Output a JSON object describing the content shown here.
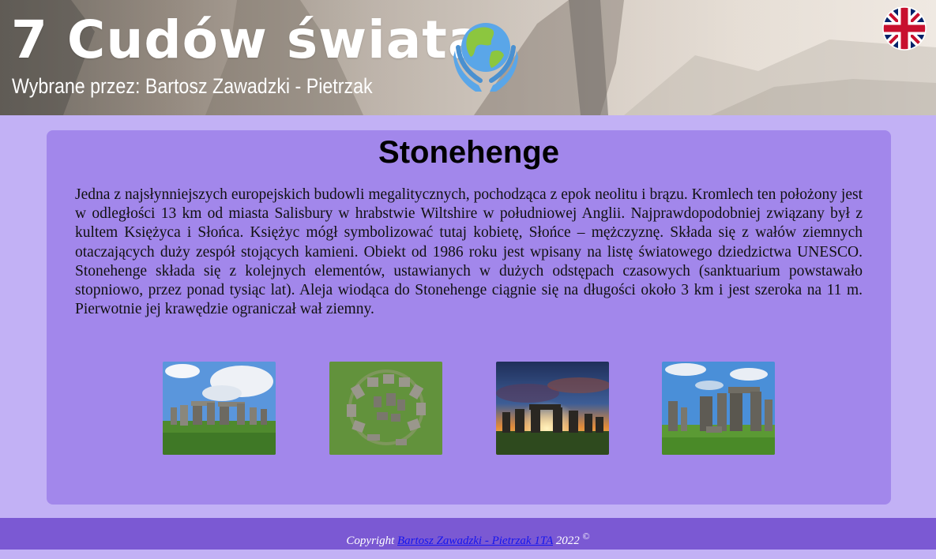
{
  "header": {
    "title": "7 Cudów świata",
    "subtitle": "Wybrane przez: Bartosz Zawadzki - Pietrzak",
    "logo_icon": "globe-in-hands-icon",
    "language_icon": "uk-flag-icon"
  },
  "article": {
    "title": "Stonehenge",
    "body": "Jedna z najsłynniejszych europejskich budowli megalitycznych, pochodząca z epok neolitu i brązu. Kromlech ten położony jest w odległości 13 km od miasta Salisbury w hrabstwie Wiltshire w południowej Anglii. Najprawdopodobniej związany był z kultem Księżyca i Słońca. Księżyc mógł symbolizować tutaj kobietę, Słońce – mężczyznę. Składa się z wałów ziemnych otaczających duży zespół stojących kamieni. Obiekt od 1986 roku jest wpisany na listę światowego dziedzictwa UNESCO. Stonehenge składa się z kolejnych elementów, ustawianych w dużych odstępach czasowych (sanktuarium powstawało stopniowo, przez ponad tysiąc lat). Aleja wiodąca do Stonehenge ciągnie się na długości około 3 km i jest szeroka na 11 m. Pierwotnie jej krawędzie ograniczał wał ziemny."
  },
  "footer": {
    "prefix": "Copyright",
    "author_link": "Bartosz Zawadzki - Pietrzak 1TA",
    "year": "2022",
    "symbol": "©"
  },
  "colors": {
    "page_background": "#c2b1f5",
    "card_background": "#a287eb",
    "footer_background": "#7b59d3",
    "link": "#1515ee"
  }
}
